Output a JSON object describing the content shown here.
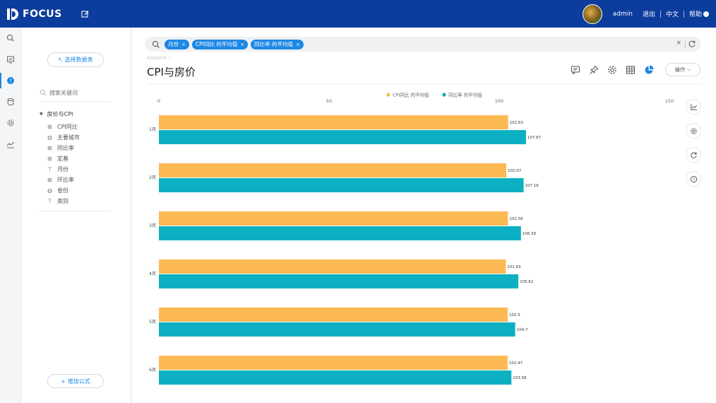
{
  "app": {
    "logo_text": "FOCUS"
  },
  "user": {
    "name": "admin",
    "logout": "退出",
    "language": "中文",
    "help": "帮助"
  },
  "panel": {
    "select_table_label": "↖ 选择数据表",
    "search_placeholder": "搜索关键词",
    "tree_root": "房价与CPI",
    "tree_items": [
      {
        "label": "CPI同比",
        "icon": "number-field-icon"
      },
      {
        "label": "主要城市",
        "icon": "globe-icon"
      },
      {
        "label": "同比率",
        "icon": "number-field-icon"
      },
      {
        "label": "定基",
        "icon": "number-field-icon"
      },
      {
        "label": "月份",
        "icon": "text-field-icon"
      },
      {
        "label": "环比率",
        "icon": "number-field-icon"
      },
      {
        "label": "省份",
        "icon": "globe-icon"
      },
      {
        "label": "类别",
        "icon": "text-field-icon"
      }
    ],
    "add_formula_label": "+ 增加公式"
  },
  "search": {
    "chips": [
      {
        "label": "月份"
      },
      {
        "label": "CPI同比 的平均值"
      },
      {
        "label": "同比率 的平均值"
      }
    ],
    "clear": "×"
  },
  "answer_label": "ANSWER 1",
  "title": "CPI与房价",
  "operate_label": "操作",
  "colors": {
    "series1": "#fcb954",
    "series2": "#0cb0c2",
    "brand": "#0c3c9c",
    "accent": "#1e88e5"
  },
  "chart_data": {
    "type": "bar",
    "orientation": "horizontal",
    "categories": [
      "1月",
      "2月",
      "3月",
      "4月",
      "5月",
      "6月"
    ],
    "series": [
      {
        "name": "CPI同比 的平均值",
        "values": [
          102.63,
          102.07,
          102.56,
          101.93,
          102.5,
          102.47
        ],
        "labels": [
          "102.63",
          "102.07",
          "102.56",
          "101.93",
          "102.5",
          "102.47"
        ]
      },
      {
        "name": "同比率 的平均值",
        "values": [
          107.87,
          107.16,
          106.39,
          105.62,
          104.7,
          103.58
        ],
        "labels": [
          "107.87",
          "107.16",
          "106.39",
          "105.62",
          "104.7",
          "103.58"
        ]
      }
    ],
    "xlim": [
      0,
      150
    ],
    "xticks": [
      "0",
      "50",
      "100",
      "150"
    ],
    "legend": "top-center",
    "grid": false
  }
}
